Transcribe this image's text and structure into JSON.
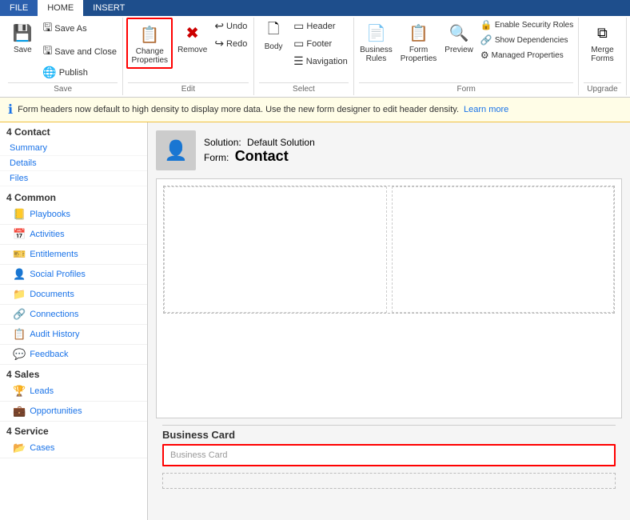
{
  "tabs": {
    "file": "FILE",
    "home": "HOME",
    "insert": "INSERT"
  },
  "ribbon": {
    "save_group": {
      "label": "Save",
      "save_btn": "Save",
      "save_as_btn": "Save As",
      "save_close_btn": "Save and Close",
      "publish_btn": "Publish"
    },
    "edit_group": {
      "label": "Edit",
      "change_properties_btn": "Change\nProperties",
      "remove_btn": "Remove",
      "undo_btn": "Undo",
      "redo_btn": "Redo"
    },
    "select_group": {
      "label": "Select",
      "body_btn": "Body",
      "header_btn": "Header",
      "footer_btn": "Footer",
      "navigation_btn": "Navigation"
    },
    "form_group": {
      "label": "Form",
      "business_rules_btn": "Business\nRules",
      "form_properties_btn": "Form\nProperties",
      "preview_btn": "Preview",
      "managed_properties_btn": "Managed Properties",
      "show_dependencies_btn": "Show Dependencies",
      "enable_security_roles_btn": "Enable Security Roles"
    },
    "upgrade_group": {
      "label": "Upgrade",
      "merge_forms_btn": "Merge\nForms"
    }
  },
  "info_bar": {
    "message": "Form headers now default to high density to display more data. Use the new form designer to edit header density.",
    "link_text": "Learn more"
  },
  "sidebar": {
    "contact_section": "4 Contact",
    "contact_items": [
      "Summary",
      "Details",
      "Files"
    ],
    "common_section": "4 Common",
    "common_items": [
      "Playbooks",
      "Activities",
      "Entitlements",
      "Social Profiles",
      "Documents",
      "Connections",
      "Audit History",
      "Feedback"
    ],
    "sales_section": "4 Sales",
    "sales_items": [
      "Leads",
      "Opportunities"
    ],
    "service_section": "4 Service",
    "service_items": [
      "Cases"
    ]
  },
  "canvas": {
    "solution_label": "Solution:",
    "solution_name": "Default Solution",
    "form_label": "Form:",
    "form_name": "Contact",
    "business_card_label": "Business Card",
    "business_card_placeholder": "Business Card"
  },
  "colors": {
    "accent_blue": "#1e4e8c",
    "highlight_red": "#cc0000",
    "info_yellow": "#fffde7"
  }
}
